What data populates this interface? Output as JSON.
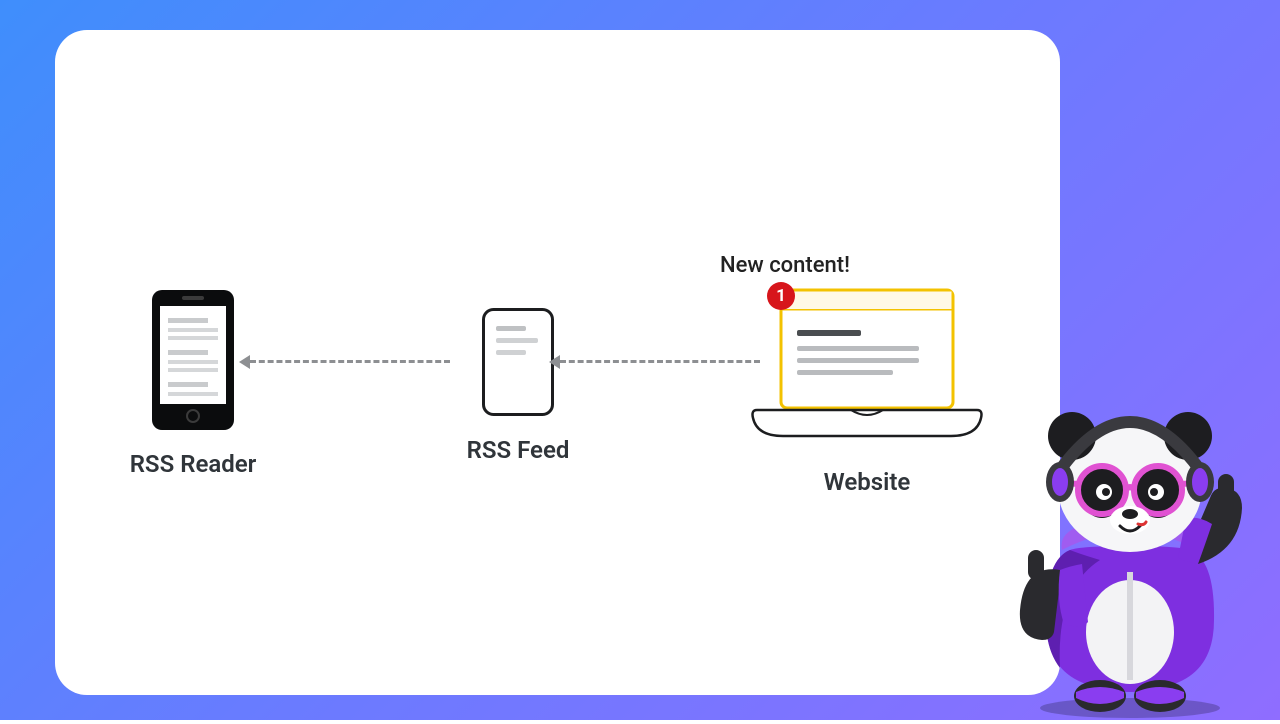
{
  "diagram": {
    "nodes": {
      "reader": {
        "label": "RSS Reader"
      },
      "feed": {
        "label": "RSS Feed"
      },
      "website": {
        "label": "Website"
      }
    },
    "annotation": {
      "new_content": "New content!"
    },
    "badge": {
      "count": "1"
    },
    "colors": {
      "accent_yellow": "#f3c200",
      "badge_red": "#d7151b",
      "text": "#30353a",
      "line": "#8d8f92"
    }
  }
}
